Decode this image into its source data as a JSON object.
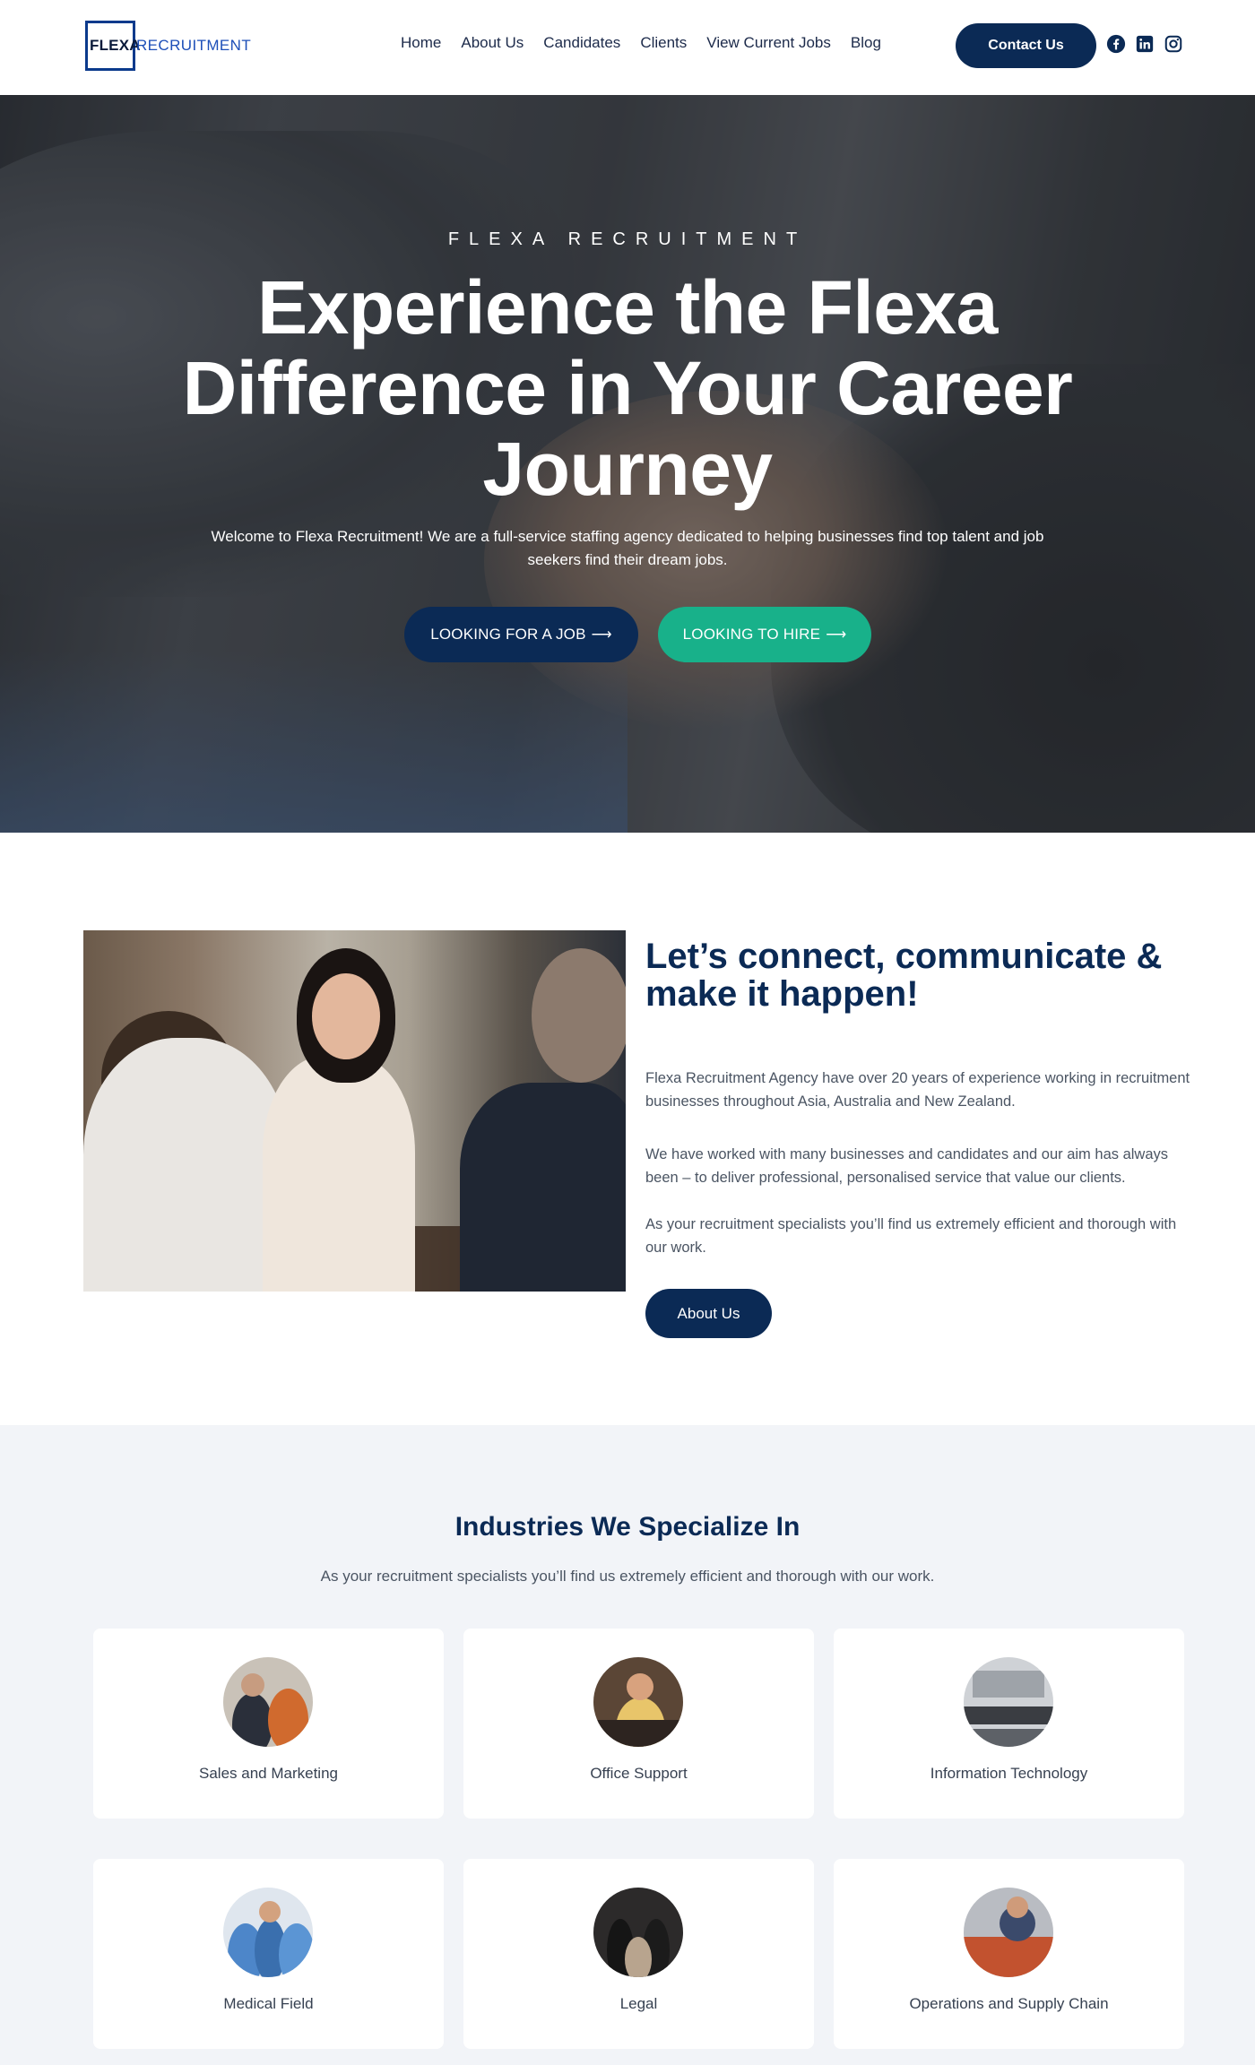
{
  "header": {
    "logo_flexa": "FLEXA",
    "logo_recruitment": "RECRUITMENT",
    "nav": [
      "Home",
      "About Us",
      "Candidates",
      "Clients",
      "View Current Jobs",
      "Blog"
    ],
    "contact_label": "Contact Us",
    "social_icons": [
      "facebook-icon",
      "linkedin-icon",
      "instagram-icon"
    ]
  },
  "hero": {
    "eyebrow": "FLEXA RECRUITMENT",
    "title": "Experience the Flexa Difference in Your Career Journey",
    "description": "Welcome to Flexa Recruitment! We are a full-service staffing agency dedicated to helping businesses find top talent and job seekers find their dream jobs.",
    "btn_job": "LOOKING FOR A JOB",
    "btn_hire": "LOOKING TO HIRE",
    "arrow": "⟶"
  },
  "about": {
    "title": "Let’s connect, communicate & make it happen!",
    "p1": "Flexa Recruitment Agency have over 20 years of experience working in recruitment businesses throughout Asia, Australia and New Zealand.",
    "p2": "We have worked with many businesses and candidates and our aim has always been – to deliver professional, personalised service that value our clients.",
    "p3": "As your recruitment specialists you’ll find us extremely efficient and thorough with our work.",
    "button": "About Us"
  },
  "industries": {
    "title": "Industries We Specialize In",
    "subtitle": "As your recruitment specialists you’ll find us extremely efficient and thorough with our work.",
    "items": [
      {
        "label": "Sales and Marketing"
      },
      {
        "label": "Office Support"
      },
      {
        "label": "Information Technology"
      },
      {
        "label": "Medical Field"
      },
      {
        "label": "Legal"
      },
      {
        "label": "Operations and Supply Chain"
      }
    ]
  },
  "colors": {
    "navy": "#0b2a55",
    "green": "#18b18a",
    "section_bg": "#f2f4f8"
  }
}
